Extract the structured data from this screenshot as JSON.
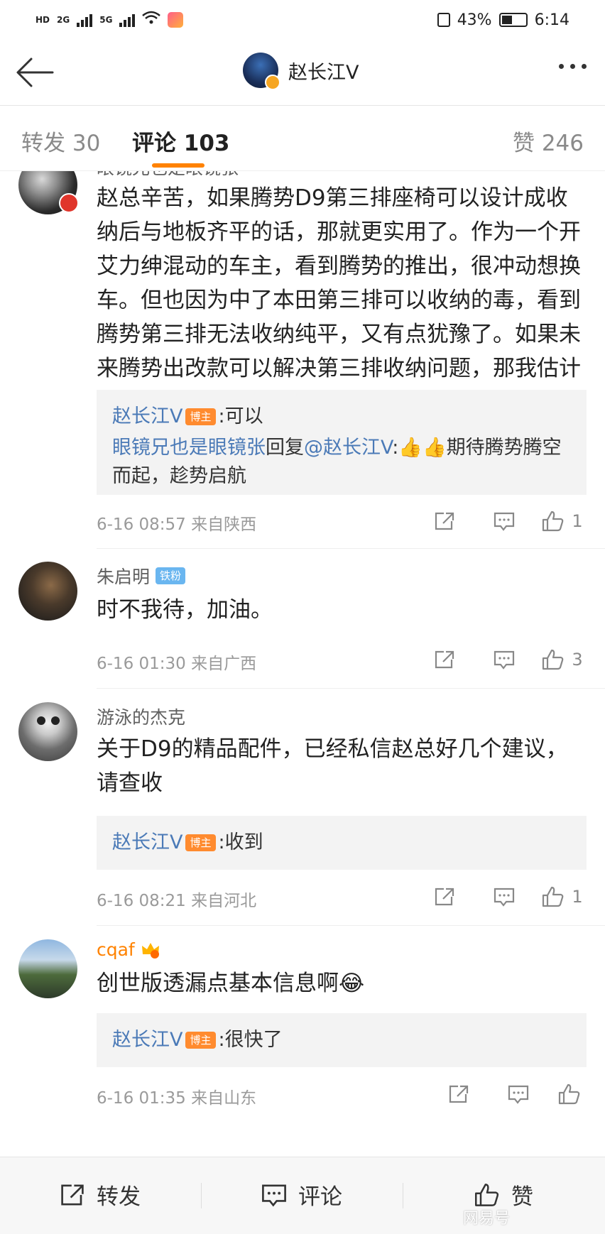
{
  "status": {
    "net1": "HD",
    "net2": "2G",
    "net3": "5G",
    "battery": "43%",
    "time": "6:14"
  },
  "header": {
    "title": "赵长江V"
  },
  "tabs": {
    "repost": "转发 30",
    "comment": "评论 103",
    "like": "赞 246"
  },
  "comments": [
    {
      "user": "眼镜兄也是眼镜张",
      "text": "赵总辛苦，如果腾势D9第三排座椅可以设计成收纳后与地板齐平的话，那就更实用了。作为一个开艾力绅混动的车主，看到腾势的推出，很冲动想换车。但也因为中了本田第三排可以收纳的毒，看到腾势第三排无法收纳纯平，又有点犹豫了。如果未来腾势出改款可以解决第三排收纳问题，那我估计就不会有这个犹豫了",
      "replies": [
        {
          "name": "赵长江V",
          "badge": "博主",
          "text": ":可以"
        },
        {
          "name": "眼镜兄也是眼镜张",
          "mid": "回复",
          "at": "@赵长江V",
          "text": ":👍👍期待腾势腾空而起，趁势启航"
        }
      ],
      "meta": "6-16 08:57 来自陕西",
      "likes": "1"
    },
    {
      "user": "朱启明",
      "badge": "铁粉",
      "text": "时不我待，加油。",
      "meta": "6-16 01:30 来自广西",
      "likes": "3"
    },
    {
      "user": "游泳的杰克",
      "text": "关于D9的精品配件，已经私信赵总好几个建议，请查收",
      "replies": [
        {
          "name": "赵长江V",
          "badge": "博主",
          "text": ":收到"
        }
      ],
      "meta": "6-16 08:21 来自河北",
      "likes": "1"
    },
    {
      "user": "cqaf",
      "text": "创世版透漏点基本信息啊😂",
      "replies": [
        {
          "name": "赵长江V",
          "badge": "博主",
          "text": ":很快了"
        }
      ],
      "meta": "6-16 01:35 来自山东",
      "likes": ""
    }
  ],
  "bottom": {
    "repost": "转发",
    "comment": "评论",
    "like": "赞"
  },
  "watermark": "网易号",
  "colors": {
    "accent": "#ff8200",
    "link": "#4b7ab7",
    "badge_bo": "#ff8b2f",
    "badge_tie": "#6ab6f0"
  }
}
